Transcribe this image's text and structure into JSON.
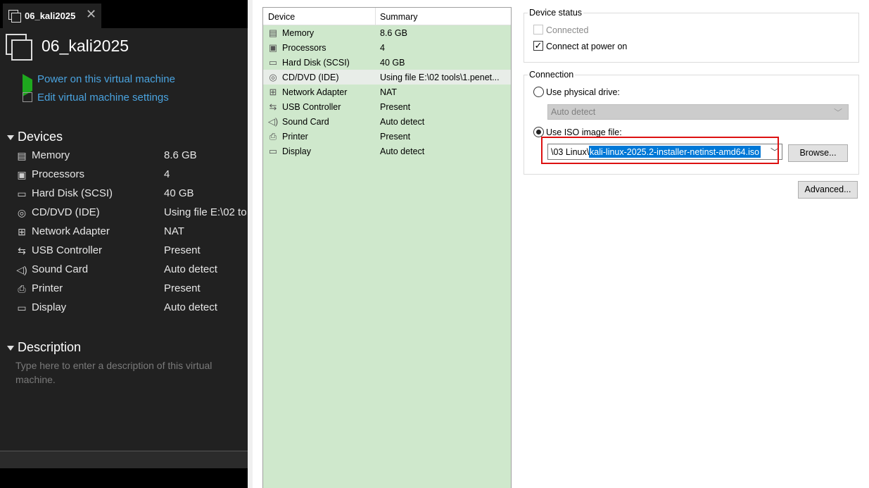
{
  "tab": {
    "title": "06_kali2025",
    "close": "✕"
  },
  "vm": {
    "name": "06_kali2025",
    "actions": [
      {
        "label": "Power on this virtual machine",
        "icon": "play-icon"
      },
      {
        "label": "Edit virtual machine settings",
        "icon": "edit-settings-icon"
      }
    ]
  },
  "devices_section": {
    "title": "Devices",
    "items": [
      {
        "name": "Memory",
        "value": "8.6 GB",
        "icon": "memory-icon"
      },
      {
        "name": "Processors",
        "value": "4",
        "icon": "processor-icon"
      },
      {
        "name": "Hard Disk (SCSI)",
        "value": "40 GB",
        "icon": "hard-disk-icon"
      },
      {
        "name": "CD/DVD (IDE)",
        "value": "Using file E:\\02 to",
        "icon": "cd-dvd-icon"
      },
      {
        "name": "Network Adapter",
        "value": "NAT",
        "icon": "network-adapter-icon"
      },
      {
        "name": "USB Controller",
        "value": "Present",
        "icon": "usb-icon"
      },
      {
        "name": "Sound Card",
        "value": "Auto detect",
        "icon": "sound-icon"
      },
      {
        "name": "Printer",
        "value": "Present",
        "icon": "printer-icon"
      },
      {
        "name": "Display",
        "value": "Auto detect",
        "icon": "display-icon"
      }
    ]
  },
  "description_section": {
    "title": "Description",
    "placeholder": "Type here to enter a description of this virtual machine."
  },
  "device_list": {
    "columns": [
      "Device",
      "Summary"
    ],
    "rows": [
      {
        "name": "Memory",
        "summary": "8.6 GB",
        "icon": "memory-icon"
      },
      {
        "name": "Processors",
        "summary": "4",
        "icon": "processor-icon"
      },
      {
        "name": "Hard Disk (SCSI)",
        "summary": "40 GB",
        "icon": "hard-disk-icon"
      },
      {
        "name": "CD/DVD (IDE)",
        "summary": "Using file E:\\02 tools\\1.penet...",
        "icon": "cd-dvd-icon",
        "selected": true
      },
      {
        "name": "Network Adapter",
        "summary": "NAT",
        "icon": "network-adapter-icon"
      },
      {
        "name": "USB Controller",
        "summary": "Present",
        "icon": "usb-icon"
      },
      {
        "name": "Sound Card",
        "summary": "Auto detect",
        "icon": "sound-icon"
      },
      {
        "name": "Printer",
        "summary": "Present",
        "icon": "printer-icon"
      },
      {
        "name": "Display",
        "summary": "Auto detect",
        "icon": "display-icon"
      }
    ]
  },
  "device_status": {
    "title": "Device status",
    "connected_label": "Connected",
    "connected_checked": false,
    "connected_enabled": false,
    "power_on_label": "Connect at power on",
    "power_on_checked": true
  },
  "connection": {
    "title": "Connection",
    "physical_label": "Use physical drive:",
    "physical_selected": false,
    "physical_value": "Auto detect",
    "iso_label": "Use ISO image file:",
    "iso_selected": true,
    "iso_path_prefix": "\\03 Linux\\",
    "iso_path_selected": "kali-linux-2025.2-installer-netinst-amd64.iso",
    "browse_label": "Browse..."
  },
  "advanced_label": "Advanced...",
  "colors": {
    "accent_link": "#4aa3df",
    "power_green": "#1ea81e",
    "selection_blue": "#0078d7",
    "highlight_red": "#dd1111",
    "device_list_bg": "#cfe8cc"
  }
}
